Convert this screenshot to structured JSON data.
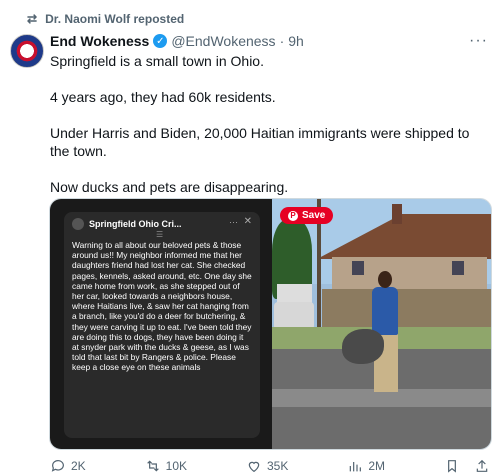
{
  "repost": {
    "label": "Dr. Naomi Wolf reposted"
  },
  "author": {
    "name": "End Wokeness",
    "handle": "@EndWokeness",
    "sep": "·",
    "time": "9h"
  },
  "tweet": {
    "lines": [
      "Springfield is a small town in Ohio.",
      "4 years ago, they had 60k residents.",
      "Under Harris and Biden, 20,000 Haitian immigrants were shipped to the town.",
      "Now ducks and pets are disappearing."
    ]
  },
  "media": {
    "fb_title": "Springfield Ohio Cri...",
    "fb_dots": "···",
    "fb_close": "✕",
    "fb_sub": "☰",
    "fb_text": "Warning to all about our beloved pets & those around us!! My neighbor informed me that her daughters friend had lost her cat. She checked pages, kennels, asked around, etc. One day she came home from work, as she stepped out of her car, looked towards a neighbors house, where Haitians live, & saw her cat hanging from a branch, like you'd do a deer for butchering, & they were carving it up to eat. I've been told they are doing this to dogs, they have been doing it at snyder park with the ducks & geese, as I was told that last bit by Rangers & police. Please keep a close eye on these animals",
    "save_label": "Save"
  },
  "actions": {
    "replies": "2K",
    "reposts": "10K",
    "likes": "35K",
    "views": "2M"
  },
  "colors": {
    "accent": "#1d9bf0",
    "save": "#e60023"
  }
}
